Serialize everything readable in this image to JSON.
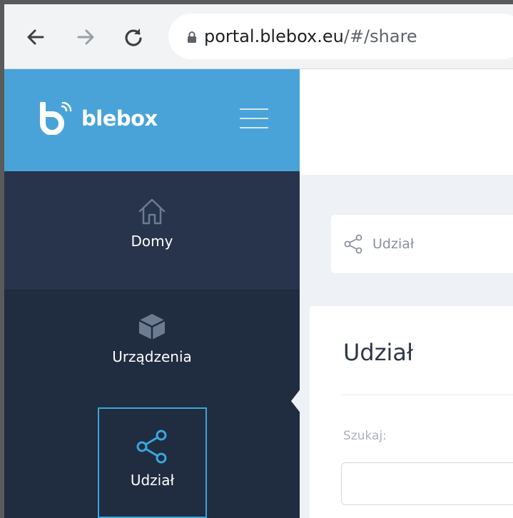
{
  "browser": {
    "url_host": "portal.blebox.eu",
    "url_path": "/#/share",
    "back_icon": "back-arrow-icon",
    "forward_icon": "forward-arrow-icon",
    "reload_icon": "reload-icon",
    "lock_icon": "lock-icon"
  },
  "brand": {
    "logo_text": "blebox",
    "menu_icon": "hamburger-icon",
    "color": "#4aa3d8"
  },
  "sidebar": {
    "items": [
      {
        "label": "Domy",
        "icon": "home-icon"
      },
      {
        "label": "Urządzenia",
        "icon": "cube-icon"
      },
      {
        "label": "Udział",
        "icon": "share-icon",
        "active": true
      }
    ],
    "background": "#243148",
    "active_border": "#3aa6dd"
  },
  "breadcrumb": {
    "label": "Udział",
    "icon": "share-icon"
  },
  "card": {
    "title": "Udział",
    "search_label": "Szukaj:",
    "search_value": ""
  }
}
